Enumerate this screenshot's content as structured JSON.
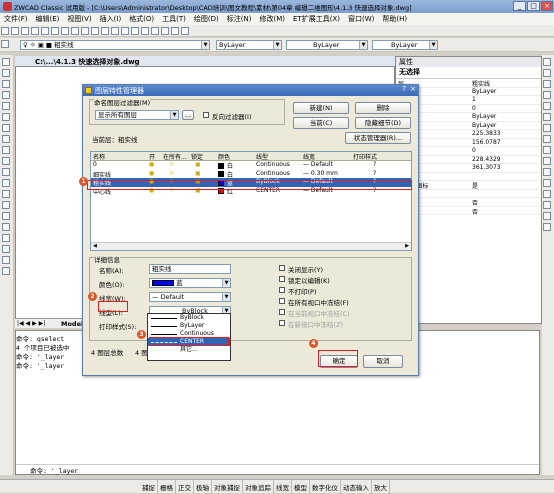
{
  "window": {
    "title": "ZWCAD Classic 试用版 - [C:\\Users\\Administrator\\Desktop\\CAD培训\\图文教程\\素材\\第04章 编辑二维图形\\4.1.3 快速选择对象.dwg]"
  },
  "menu": [
    "文件(F)",
    "编辑(E)",
    "视图(V)",
    "插入(I)",
    "格式(O)",
    "工具(T)",
    "绘图(D)",
    "标注(N)",
    "修改(M)",
    "ET扩展工具(X)",
    "窗口(W)",
    "帮助(H)"
  ],
  "toolbar": {
    "layer_current": "粗实线",
    "color": "ByLayer",
    "linetype": "ByLayer",
    "lineweight": "ByLayer"
  },
  "doc_tab": "C:\\...\\4.1.3 快速选择对象.dwg",
  "model_tab": "Model",
  "props": {
    "title": "属性",
    "selection": "无选择",
    "rows": [
      {
        "k": "层",
        "v": "粗实线"
      },
      {
        "k": "型",
        "v": "ByLayer"
      },
      {
        "k": "型比例",
        "v": "1"
      },
      {
        "k": "度",
        "v": "0"
      },
      {
        "k": "色",
        "v": "ByLayer"
      },
      {
        "k": "宽",
        "v": "ByLayer"
      },
      {
        "k": "心点X",
        "v": "225.3833"
      },
      {
        "k": "心点Y",
        "v": "156.0787"
      },
      {
        "k": "心点Z",
        "v": "0"
      },
      {
        "k": "度",
        "v": "228.4329"
      },
      {
        "k": "宽",
        "v": "361.3073"
      },
      {
        "k": "它",
        "v": ""
      },
      {
        "k": "开UCS图标",
        "v": "是"
      },
      {
        "k": "S名称",
        "v": ""
      },
      {
        "k": "开捕捉",
        "v": "否"
      },
      {
        "k": "开栅格",
        "v": "否"
      }
    ]
  },
  "cmd": [
    "命令: qselect",
    "4 个项目已被选中",
    "命令: '_layer",
    "命令: '_layer",
    "命令: '_layer"
  ],
  "status": [
    "捕捉",
    "栅格",
    "正交",
    "极轴",
    "对象捕捉",
    "对象追踪",
    "线宽",
    "模型",
    "数字化仪",
    "动态输入",
    "放大"
  ],
  "dialog": {
    "title": "图层特性管理器",
    "filter_label": "命名图层过滤器(M)",
    "filter_value": "显示所有图层",
    "invert_filter": "反向过滤器(I)",
    "current_layer": "当前层：粗实线",
    "buttons": {
      "new": "新建(N)",
      "delete": "删除",
      "current": "当前(C)",
      "hide_details": "隐藏细节(D)",
      "state": "状态管理器(R)...",
      "ok": "确定",
      "cancel": "取消"
    },
    "columns": [
      "名称",
      "开",
      "在所有...",
      "锁定",
      "颜色",
      "线型",
      "线宽",
      "打印样式"
    ],
    "layers": [
      {
        "name": "0",
        "color": "白",
        "color_hex": "#000000",
        "linetype": "Continuous",
        "lw": "— Default",
        "ps": "?"
      },
      {
        "name": "细实线",
        "color": "白",
        "color_hex": "#000000",
        "linetype": "Continuous",
        "lw": "— 0.30 mm",
        "ps": "?"
      },
      {
        "name": "粗实线",
        "color": "蓝",
        "color_hex": "#0000ff",
        "linetype": "ByBlock",
        "lw": "— Default",
        "ps": "?"
      },
      {
        "name": "中心线",
        "color": "红",
        "color_hex": "#ff0000",
        "linetype": "CENTER",
        "lw": "— Default",
        "ps": "?"
      }
    ],
    "details_title": "详细信息",
    "name_label": "名称(A):",
    "name_value": "粗实线",
    "color_label": "颜色(O):",
    "color_value": "蓝",
    "lw_label": "线宽(W):",
    "lw_value": "— Default",
    "lt_label": "线型(L):",
    "lt_value": "ByBlock",
    "ps_label": "打印样式(S):",
    "checks": [
      "关闭显示(Y)",
      "锁定以编辑(K)",
      "不打印(P)",
      "在所有视口中冻结(F)",
      "在当前视口中冻结(C)",
      "在新视口中冻结(Z)"
    ],
    "footer": "4 图层总数",
    "footer2": "4 图",
    "dropdown": [
      "ByBlock",
      "ByLayer",
      "Continuous",
      "CENTER",
      "其它..."
    ]
  },
  "badges": [
    "1",
    "2",
    "3",
    "4"
  ],
  "colors": {
    "accent": "#3a6ab8",
    "highlight": "#e02020",
    "select": "#3164b4"
  }
}
